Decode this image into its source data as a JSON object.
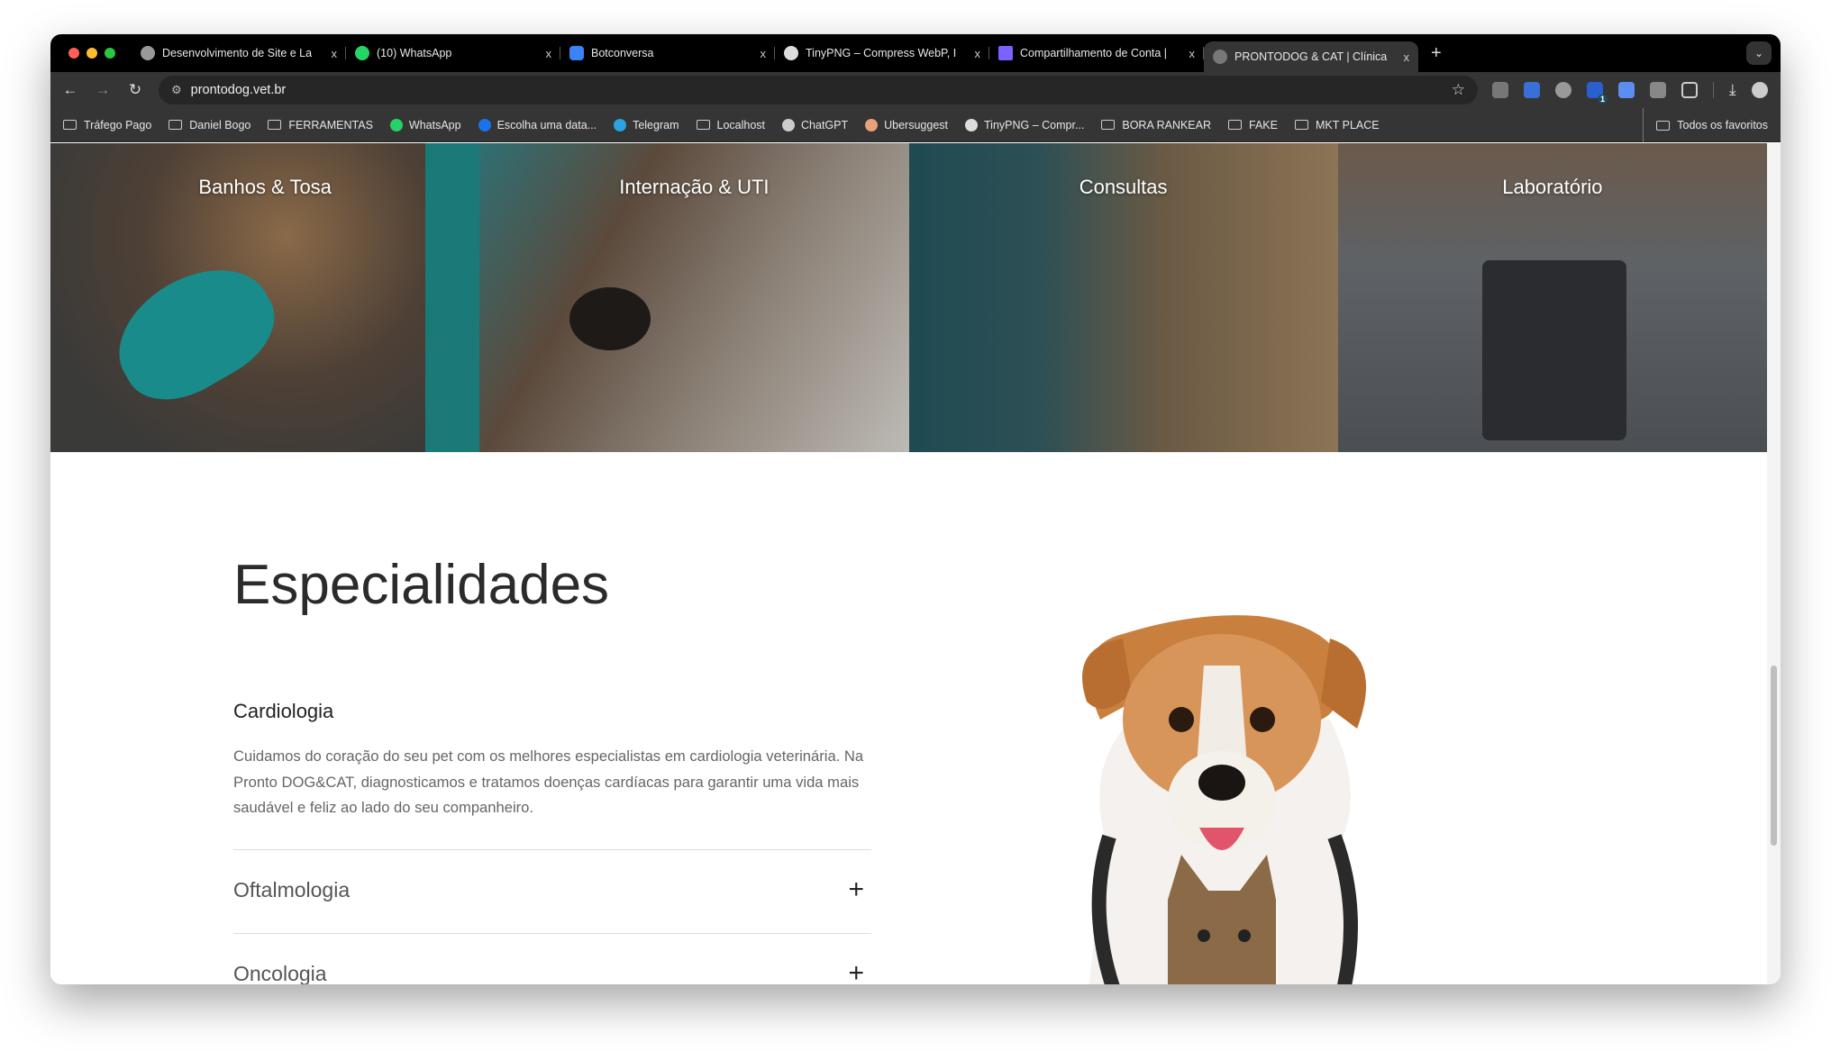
{
  "browser": {
    "tabs": [
      {
        "title": "Desenvolvimento de Site e La",
        "icon": "person-favicon",
        "color": "#999"
      },
      {
        "title": "(10) WhatsApp",
        "icon": "whatsapp-icon",
        "color": "#25d366"
      },
      {
        "title": "Botconversa",
        "icon": "bot-icon",
        "color": "#3b82f6"
      },
      {
        "title": "TinyPNG – Compress WebP, I",
        "icon": "panda-icon",
        "color": "#ddd"
      },
      {
        "title": "Compartilhamento de Conta |",
        "icon": "h-logo-icon",
        "color": "#7b61ff"
      },
      {
        "title": "PRONTODOG & CAT | Clínica",
        "icon": "globe-icon",
        "color": "#777",
        "active": true
      }
    ],
    "close_glyph": "x",
    "new_tab": "+",
    "url": "prontodog.vet.br",
    "bookmarks": [
      {
        "label": "Tráfego Pago",
        "type": "folder"
      },
      {
        "label": "Daniel Bogo",
        "type": "folder"
      },
      {
        "label": "FERRAMENTAS",
        "type": "folder"
      },
      {
        "label": "WhatsApp",
        "type": "site",
        "color": "#25d366"
      },
      {
        "label": "Escolha uma data...",
        "type": "site",
        "color": "#1a73e8"
      },
      {
        "label": "Telegram",
        "type": "site",
        "color": "#2aa3e0"
      },
      {
        "label": "Localhost",
        "type": "folder"
      },
      {
        "label": "ChatGPT",
        "type": "site",
        "color": "#ccc"
      },
      {
        "label": "Ubersuggest",
        "type": "site",
        "color": "#e8a17a"
      },
      {
        "label": "TinyPNG – Compr...",
        "type": "site",
        "color": "#ddd"
      },
      {
        "label": "BORA RANKEAR",
        "type": "folder"
      },
      {
        "label": "FAKE",
        "type": "folder"
      },
      {
        "label": "MKT PLACE",
        "type": "folder"
      }
    ],
    "all_bookmarks": "Todos os favoritos",
    "extension_badge": "1"
  },
  "hero": {
    "panels": [
      {
        "label": "Banhos & Tosa"
      },
      {
        "label": "Internação & UTI"
      },
      {
        "label": "Consultas"
      },
      {
        "label": "Laboratório"
      }
    ]
  },
  "specialties": {
    "title": "Especialidades",
    "open_item": {
      "title": "Cardiologia",
      "text": "Cuidamos do coração do seu pet com os melhores especialistas em cardiologia veterinária. Na Pronto DOG&CAT, diagnosticamos e tratamos doenças cardíacas para garantir uma vida mais saudável e feliz ao lado do seu companheiro."
    },
    "items": [
      {
        "title": "Oftalmologia"
      },
      {
        "title": "Oncologia"
      }
    ],
    "expand_glyph": "+"
  }
}
